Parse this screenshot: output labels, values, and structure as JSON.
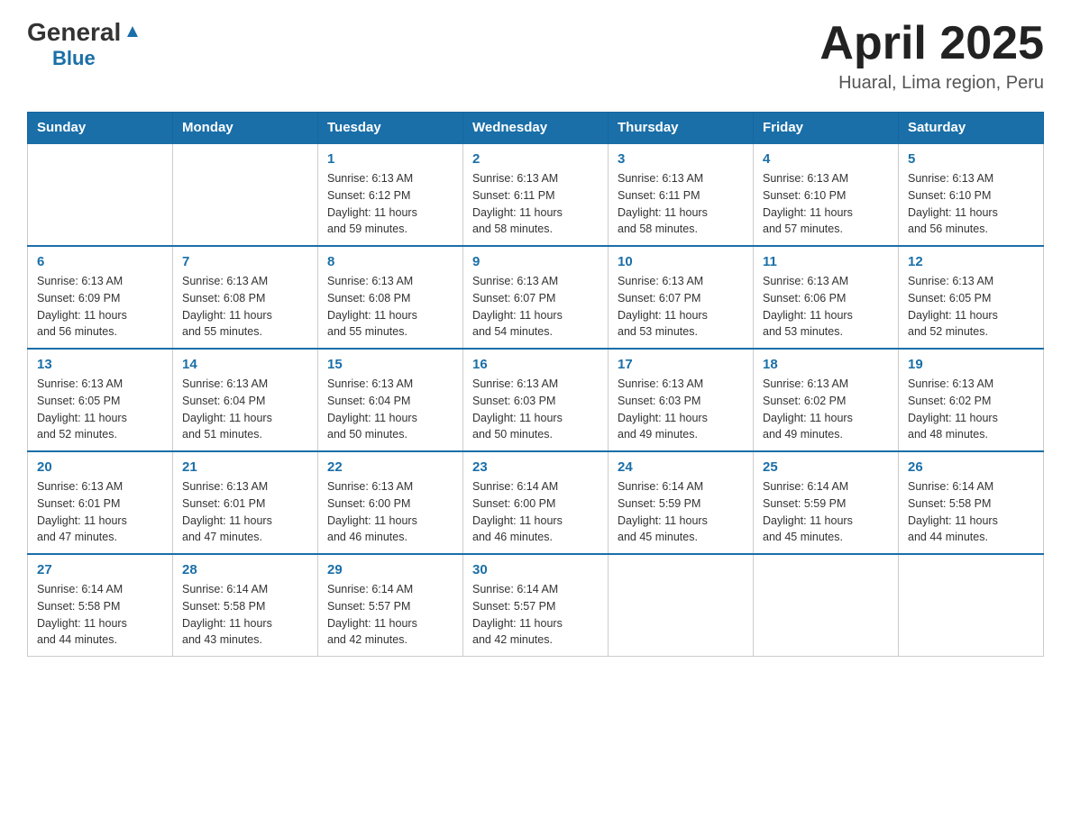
{
  "logo": {
    "general": "General",
    "triangle": "▲",
    "blue": "Blue"
  },
  "title": "April 2025",
  "subtitle": "Huaral, Lima region, Peru",
  "weekdays": [
    "Sunday",
    "Monday",
    "Tuesday",
    "Wednesday",
    "Thursday",
    "Friday",
    "Saturday"
  ],
  "weeks": [
    [
      {
        "day": "",
        "info": ""
      },
      {
        "day": "",
        "info": ""
      },
      {
        "day": "1",
        "info": "Sunrise: 6:13 AM\nSunset: 6:12 PM\nDaylight: 11 hours\nand 59 minutes."
      },
      {
        "day": "2",
        "info": "Sunrise: 6:13 AM\nSunset: 6:11 PM\nDaylight: 11 hours\nand 58 minutes."
      },
      {
        "day": "3",
        "info": "Sunrise: 6:13 AM\nSunset: 6:11 PM\nDaylight: 11 hours\nand 58 minutes."
      },
      {
        "day": "4",
        "info": "Sunrise: 6:13 AM\nSunset: 6:10 PM\nDaylight: 11 hours\nand 57 minutes."
      },
      {
        "day": "5",
        "info": "Sunrise: 6:13 AM\nSunset: 6:10 PM\nDaylight: 11 hours\nand 56 minutes."
      }
    ],
    [
      {
        "day": "6",
        "info": "Sunrise: 6:13 AM\nSunset: 6:09 PM\nDaylight: 11 hours\nand 56 minutes."
      },
      {
        "day": "7",
        "info": "Sunrise: 6:13 AM\nSunset: 6:08 PM\nDaylight: 11 hours\nand 55 minutes."
      },
      {
        "day": "8",
        "info": "Sunrise: 6:13 AM\nSunset: 6:08 PM\nDaylight: 11 hours\nand 55 minutes."
      },
      {
        "day": "9",
        "info": "Sunrise: 6:13 AM\nSunset: 6:07 PM\nDaylight: 11 hours\nand 54 minutes."
      },
      {
        "day": "10",
        "info": "Sunrise: 6:13 AM\nSunset: 6:07 PM\nDaylight: 11 hours\nand 53 minutes."
      },
      {
        "day": "11",
        "info": "Sunrise: 6:13 AM\nSunset: 6:06 PM\nDaylight: 11 hours\nand 53 minutes."
      },
      {
        "day": "12",
        "info": "Sunrise: 6:13 AM\nSunset: 6:05 PM\nDaylight: 11 hours\nand 52 minutes."
      }
    ],
    [
      {
        "day": "13",
        "info": "Sunrise: 6:13 AM\nSunset: 6:05 PM\nDaylight: 11 hours\nand 52 minutes."
      },
      {
        "day": "14",
        "info": "Sunrise: 6:13 AM\nSunset: 6:04 PM\nDaylight: 11 hours\nand 51 minutes."
      },
      {
        "day": "15",
        "info": "Sunrise: 6:13 AM\nSunset: 6:04 PM\nDaylight: 11 hours\nand 50 minutes."
      },
      {
        "day": "16",
        "info": "Sunrise: 6:13 AM\nSunset: 6:03 PM\nDaylight: 11 hours\nand 50 minutes."
      },
      {
        "day": "17",
        "info": "Sunrise: 6:13 AM\nSunset: 6:03 PM\nDaylight: 11 hours\nand 49 minutes."
      },
      {
        "day": "18",
        "info": "Sunrise: 6:13 AM\nSunset: 6:02 PM\nDaylight: 11 hours\nand 49 minutes."
      },
      {
        "day": "19",
        "info": "Sunrise: 6:13 AM\nSunset: 6:02 PM\nDaylight: 11 hours\nand 48 minutes."
      }
    ],
    [
      {
        "day": "20",
        "info": "Sunrise: 6:13 AM\nSunset: 6:01 PM\nDaylight: 11 hours\nand 47 minutes."
      },
      {
        "day": "21",
        "info": "Sunrise: 6:13 AM\nSunset: 6:01 PM\nDaylight: 11 hours\nand 47 minutes."
      },
      {
        "day": "22",
        "info": "Sunrise: 6:13 AM\nSunset: 6:00 PM\nDaylight: 11 hours\nand 46 minutes."
      },
      {
        "day": "23",
        "info": "Sunrise: 6:14 AM\nSunset: 6:00 PM\nDaylight: 11 hours\nand 46 minutes."
      },
      {
        "day": "24",
        "info": "Sunrise: 6:14 AM\nSunset: 5:59 PM\nDaylight: 11 hours\nand 45 minutes."
      },
      {
        "day": "25",
        "info": "Sunrise: 6:14 AM\nSunset: 5:59 PM\nDaylight: 11 hours\nand 45 minutes."
      },
      {
        "day": "26",
        "info": "Sunrise: 6:14 AM\nSunset: 5:58 PM\nDaylight: 11 hours\nand 44 minutes."
      }
    ],
    [
      {
        "day": "27",
        "info": "Sunrise: 6:14 AM\nSunset: 5:58 PM\nDaylight: 11 hours\nand 44 minutes."
      },
      {
        "day": "28",
        "info": "Sunrise: 6:14 AM\nSunset: 5:58 PM\nDaylight: 11 hours\nand 43 minutes."
      },
      {
        "day": "29",
        "info": "Sunrise: 6:14 AM\nSunset: 5:57 PM\nDaylight: 11 hours\nand 42 minutes."
      },
      {
        "day": "30",
        "info": "Sunrise: 6:14 AM\nSunset: 5:57 PM\nDaylight: 11 hours\nand 42 minutes."
      },
      {
        "day": "",
        "info": ""
      },
      {
        "day": "",
        "info": ""
      },
      {
        "day": "",
        "info": ""
      }
    ]
  ]
}
